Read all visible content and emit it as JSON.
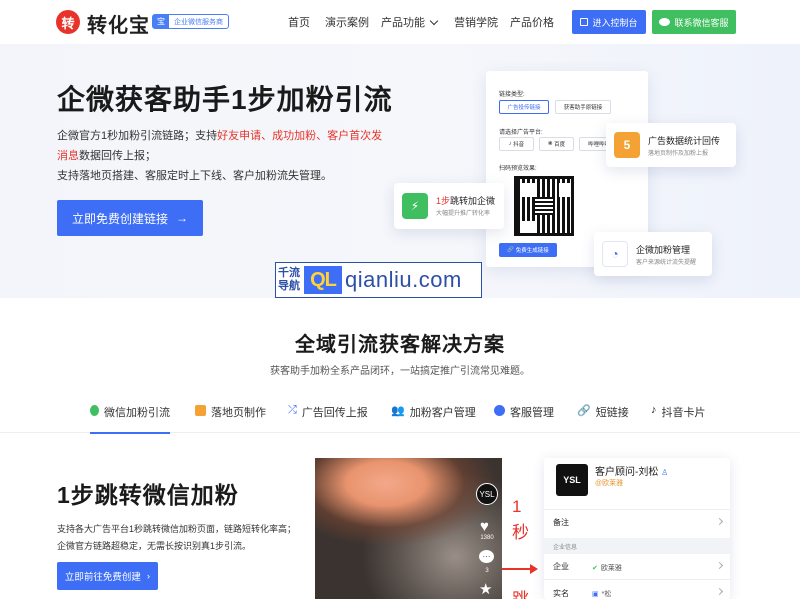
{
  "brand": {
    "logo_char": "转",
    "name": "转化宝",
    "tag_icon": "宝",
    "tag": "企业微信服务商"
  },
  "nav": {
    "links": [
      "首页",
      "演示案例",
      "产品功能",
      "营销学院",
      "产品价格"
    ],
    "console_button": "进入控制台",
    "contact_button": "联系微信客服"
  },
  "hero": {
    "title": "企微获客助手1步加粉引流",
    "desc_line1_a": "企微官方1秒加粉引流链路；支持",
    "desc_line1_red": "好友申请、成功加粉、客户首次发消息",
    "desc_line1_b": "数据回传上报；",
    "desc_line2": "支持落地页搭建、客服定时上下线、客户加粉流失管理。",
    "cta": "立即免费创建链接",
    "cta_arrow": "→"
  },
  "mock_panel": {
    "link_type_label": "链接类型:",
    "link_types": [
      "广告投传链接",
      "获客助手原链接"
    ],
    "platform_label": "请选择广告平台:",
    "platforms": [
      "抖音",
      "百度",
      "哔哩哔哩"
    ],
    "qr_label": "扫码预览效果:",
    "generate_button": "免费生成链接"
  },
  "float_cards": {
    "stats": {
      "title": "广告数据统计回传",
      "sub": "落地页制作及加粉上报"
    },
    "jump": {
      "title_red": "1步",
      "title": "跳转加企微",
      "sub": "大幅提升推广转化率"
    },
    "manage": {
      "title": "企微加粉管理",
      "sub": "客户来源统计流失提醒"
    }
  },
  "watermark": {
    "cn_line1": "千流",
    "cn_line2": "导航",
    "badge": "QL",
    "url": "qianliu.com"
  },
  "solutions": {
    "title": "全域引流获客解决方案",
    "subtitle": "获客助手加粉全系产品闭环，一站搞定推广引流常见难题。",
    "tabs": [
      {
        "label": "微信加粉引流",
        "icon": "wechat-icon",
        "color": "#3fbf5f"
      },
      {
        "label": "落地页制作",
        "icon": "html5-icon",
        "color": "#f4a233"
      },
      {
        "label": "广告回传上报",
        "icon": "shuffle-icon",
        "color": "#3d6ef5"
      },
      {
        "label": "加粉客户管理",
        "icon": "users-icon",
        "color": "#3fbf5f"
      },
      {
        "label": "客服管理",
        "icon": "headset-icon",
        "color": "#3d6ef5"
      },
      {
        "label": "短链接",
        "icon": "link-icon",
        "color": "#555555"
      },
      {
        "label": "抖音卡片",
        "icon": "tiktok-icon",
        "color": "#222222"
      }
    ]
  },
  "feature": {
    "title": "1步跳转微信加粉",
    "desc_line1": "支持各大广告平台1秒跳转微信加粉页面，链路短转化率高；",
    "desc_line2": "企微官方链路超稳定，无需长按识别真1步引流。",
    "cta": "立即前往免费创建",
    "cta_arrow": "›"
  },
  "video": {
    "avatar_text": "YSL",
    "likes": "1380",
    "comments": "3"
  },
  "arrow_text": {
    "one": "1",
    "sec": "秒",
    "jump": "跳"
  },
  "profile": {
    "logo_text": "YSL",
    "name": "客户顾问-刘松",
    "org": "@欧莱雅",
    "remark_label": "备注",
    "section_label": "企业信息",
    "company_label": "企业",
    "company_value": "欧莱雅",
    "realname_label": "实名",
    "realname_value": "*松"
  }
}
